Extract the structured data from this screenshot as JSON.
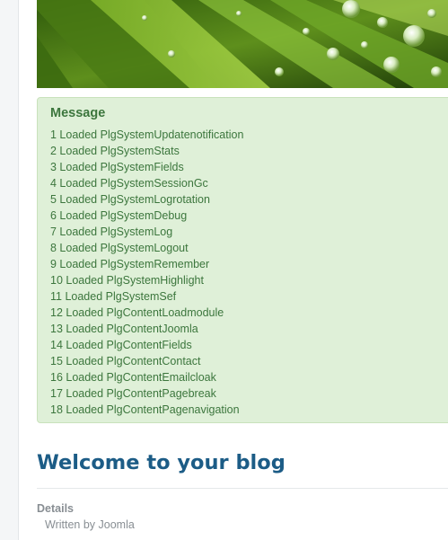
{
  "banner": {
    "image": "grass-water-droplets"
  },
  "message": {
    "heading": "Message",
    "items": [
      "1 Loaded PlgSystemUpdatenotification",
      "2 Loaded PlgSystemStats",
      "3 Loaded PlgSystemFields",
      "4 Loaded PlgSystemSessionGc",
      "5 Loaded PlgSystemLogrotation",
      "6 Loaded PlgSystemDebug",
      "7 Loaded PlgSystemLog",
      "8 Loaded PlgSystemLogout",
      "9 Loaded PlgSystemRemember",
      "10 Loaded PlgSystemHighlight",
      "11 Loaded PlgSystemSef",
      "12 Loaded PlgContentLoadmodule",
      "13 Loaded PlgContentJoomla",
      "14 Loaded PlgContentFields",
      "15 Loaded PlgContentContact",
      "16 Loaded PlgContentEmailcloak",
      "17 Loaded PlgContentPagebreak",
      "18 Loaded PlgContentPagenavigation"
    ]
  },
  "article": {
    "title": "Welcome to your blog",
    "details_label": "Details",
    "written_by": "Written by Joomla"
  },
  "colors": {
    "message_bg": "#dff0d8",
    "message_text": "#3c763d",
    "title": "#1c5c86",
    "muted": "#888e93"
  }
}
